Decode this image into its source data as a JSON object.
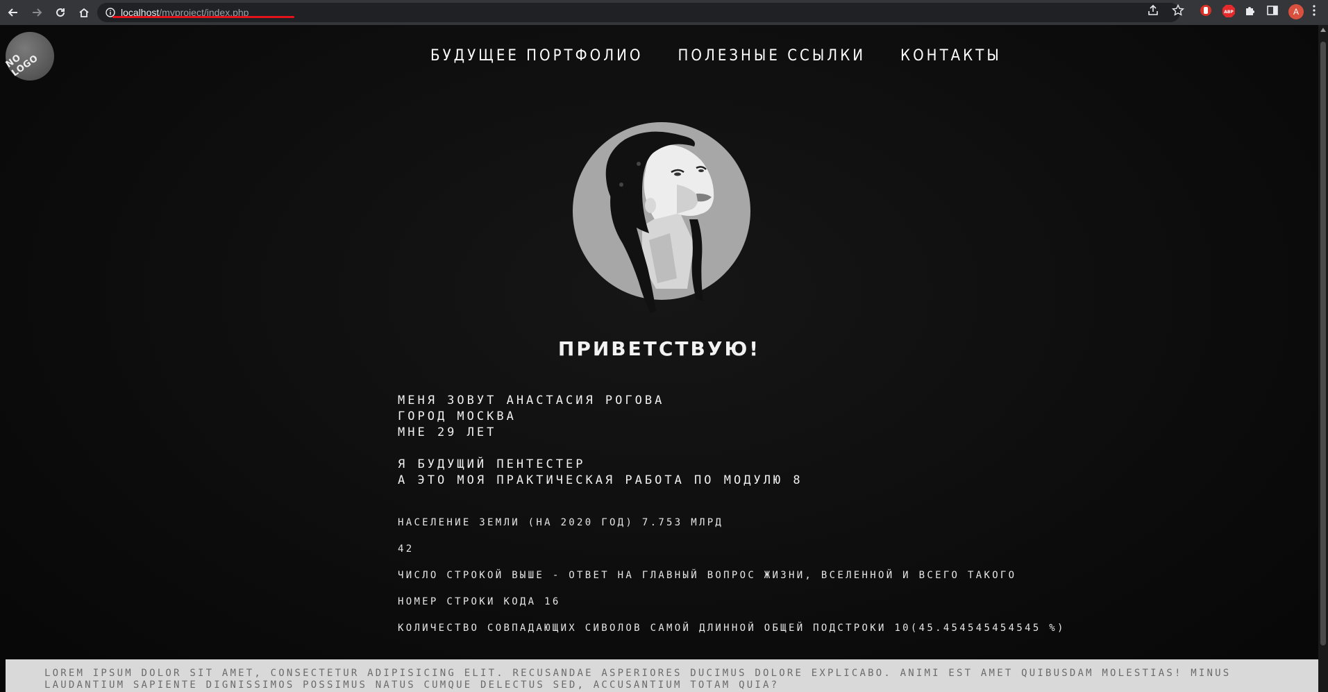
{
  "browser": {
    "url_host": "localhost",
    "url_path": "/myproject/index.php",
    "profile_initial": "A"
  },
  "logo": {
    "text": "NO LOGO"
  },
  "menu": {
    "items": [
      {
        "label": "БУДУЩЕЕ ПОРТФОЛИО"
      },
      {
        "label": "ПОЛЕЗНЫЕ ССЫЛКИ"
      },
      {
        "label": "КОНТАКТЫ"
      }
    ]
  },
  "hero": {
    "greeting": "ПРИВЕТСТВУЮ!"
  },
  "bio": {
    "line1": "Меня зовут Анастасия Рогова",
    "line2": "Город Москва",
    "line3": "Мне 29 лет",
    "line4": "Я будущий пентестер",
    "line5": "А это моя практическая работа по модулю 8"
  },
  "facts": {
    "population": "НАСЕЛЕНИЕ ЗЕМЛИ (НА 2020 ГОД) 7.753 МЛРД",
    "answer": "42",
    "answer_note": "ЧИСЛО СТРОКОЙ ВЫШЕ - ОТВЕТ НА ГЛАВНЫЙ ВОПРОС ЖИЗНИ, ВСЕЛЕННОЙ И ВСЕГО ТАКОГО",
    "line_number": "НОМЕР СТРОКИ КОДА 16",
    "common_substring": "КОЛИЧЕСТВО СОВПАДАЮЩИХ СИВОЛОВ САМОЙ ДЛИННОЙ ОБЩЕЙ ПОДСТРОКИ 10(45.454545454545 %)"
  },
  "footer": {
    "text": "Lorem ipsum dolor sit amet, consectetur adipisicing elit. Recusandae asperiores ducimus dolore explicabo. Animi est amet quibusdam molestias! Minus laudantium sapiente dignissimos possimus natus cumque delectus sed, accusantium totam quia?"
  },
  "colors": {
    "page_bg": "#0d0d0d",
    "avatar_circle": "#a7a7a7",
    "footer_bg": "#d9d9d9",
    "url_underline": "#e3121b"
  }
}
